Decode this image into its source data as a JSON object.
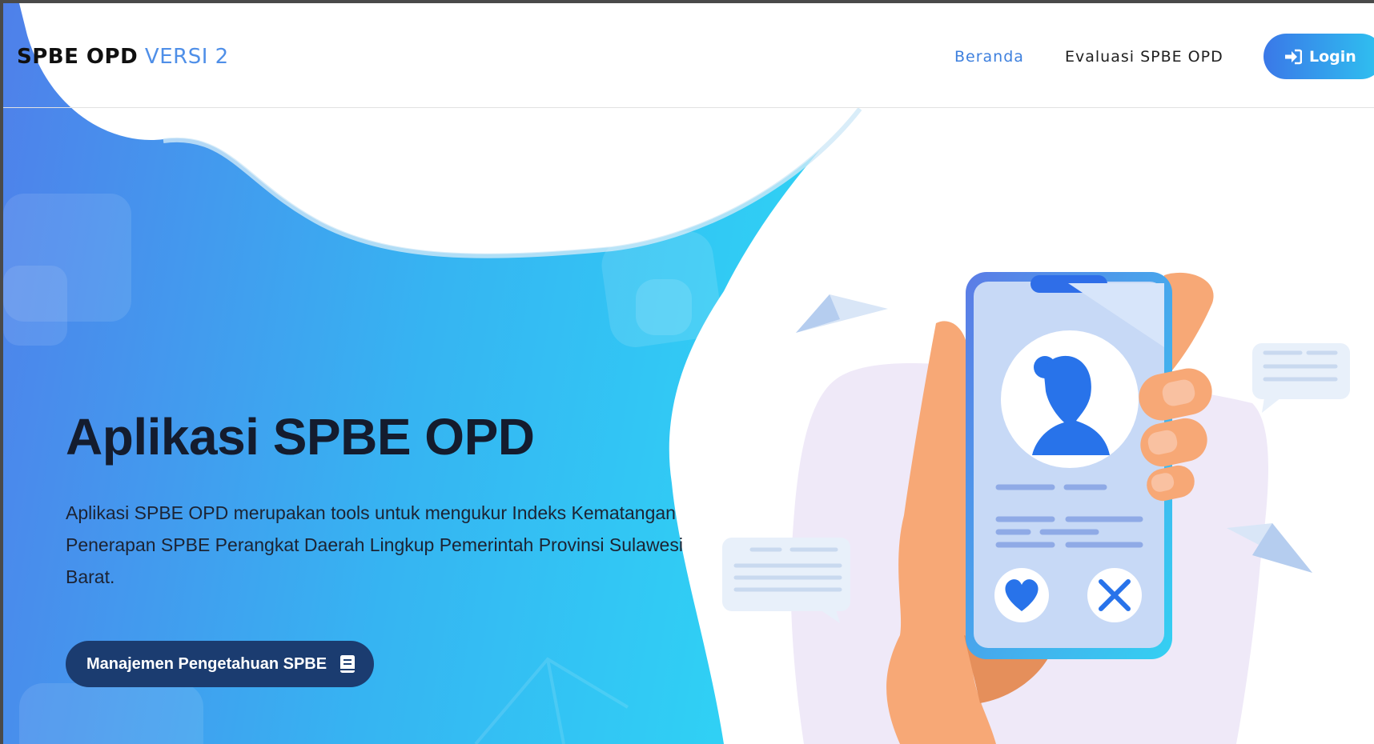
{
  "brand": {
    "name": "SPBE OPD",
    "version": "VERSI 2"
  },
  "nav": {
    "items": [
      {
        "label": "Beranda",
        "active": true
      },
      {
        "label": "Evaluasi SPBE OPD",
        "active": false
      }
    ],
    "login_label": "Login",
    "login_icon": "sign-in-icon"
  },
  "hero": {
    "title": "Aplikasi SPBE OPD",
    "description": "Aplikasi SPBE OPD merupakan tools untuk mengukur Indeks Kematangan Penerapan SPBE Perangkat Daerah Lingkup Pemerintah Provinsi Sulawesi Barat.",
    "cta_label": "Manajemen Pengetahuan SPBE",
    "cta_icon": "book-icon"
  },
  "colors": {
    "accent": "#3e80de",
    "gradient_start": "#4f80ea",
    "gradient_end": "#2fd0f5",
    "cta_background": "#1b3c70",
    "title_text": "#141c2e"
  }
}
